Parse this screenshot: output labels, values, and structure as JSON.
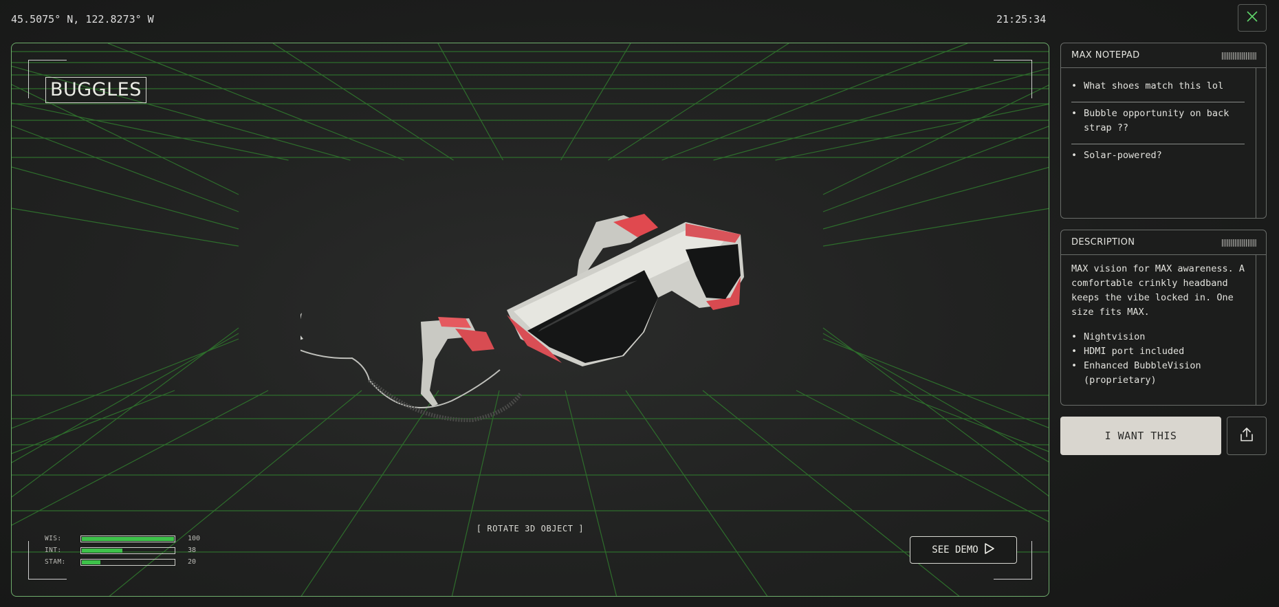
{
  "header": {
    "coordinates": "45.5075° N, 122.8273° W",
    "clock": "21:25:34"
  },
  "viewer": {
    "title": "BUGGLES",
    "rotate_hint": "[ ROTATE 3D OBJECT ]",
    "demo_label": "SEE DEMO",
    "grid_color": "#2e6e2c",
    "stats": [
      {
        "label": "WIS:",
        "value": "100",
        "fill": 1.0
      },
      {
        "label": "INT:",
        "value": "38",
        "fill": 0.44
      },
      {
        "label": "STAM:",
        "value": "20",
        "fill": 0.2
      }
    ]
  },
  "notepad": {
    "title": "MAX NOTEPAD",
    "notes": [
      "What shoes match this lol",
      "Bubble opportunity on back strap ??",
      "Solar-powered?"
    ]
  },
  "description": {
    "title": "DESCRIPTION",
    "text": "MAX vision for MAX awareness. A comfortable crinkly headband keeps the vibe locked in. One size fits MAX.",
    "features": [
      "Nightvision",
      "HDMI port included",
      "Enhanced BubbleVision (proprietary)"
    ]
  },
  "actions": {
    "want_label": "I WANT THIS"
  },
  "icons": {
    "close": "close-icon",
    "play": "play-icon",
    "share": "share-icon"
  },
  "colors": {
    "accent_green": "#6fae6c",
    "bar_green": "#3ec24a",
    "button_light": "#d9d6cf"
  }
}
